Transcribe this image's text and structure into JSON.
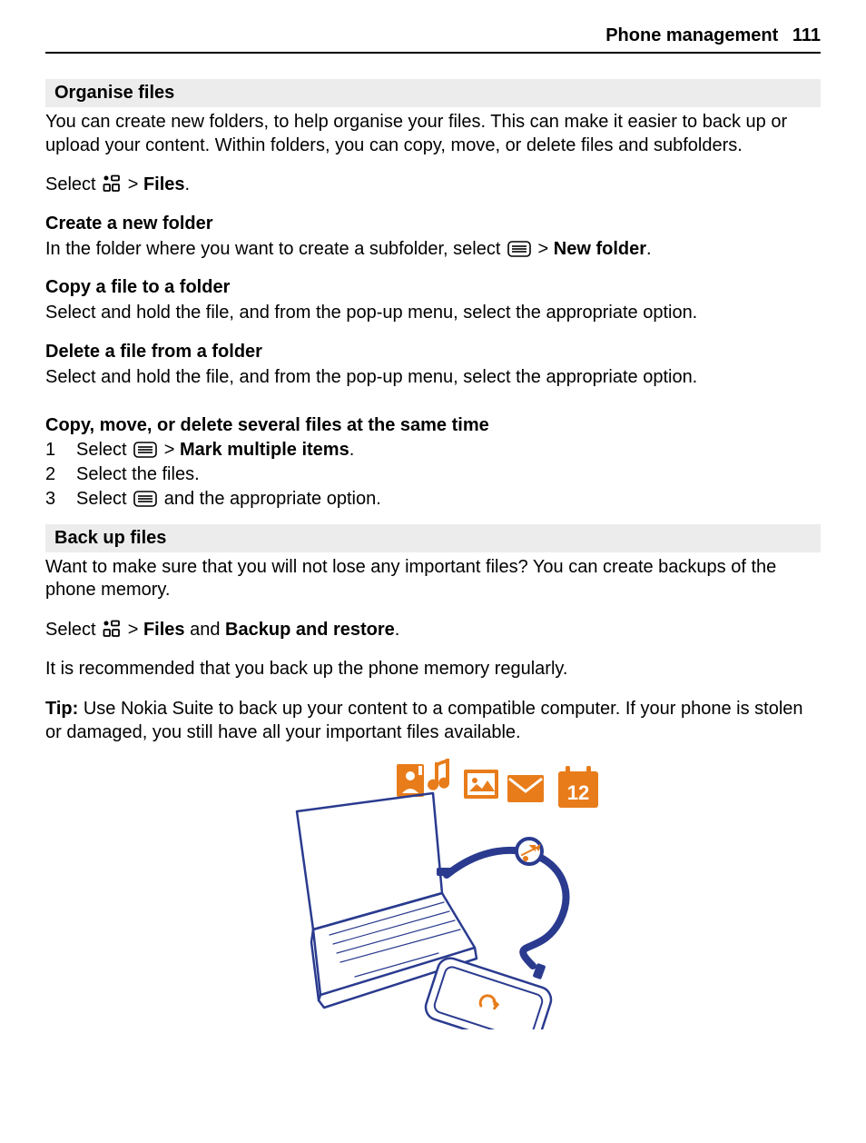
{
  "header": {
    "title": "Phone management",
    "page_number": "111"
  },
  "s1": {
    "title": "Organise files",
    "intro": "You can create new folders, to help organise your files. This can make it easier to back up or upload your content. Within folders, you can copy, move, or delete files and subfolders.",
    "select_pre": "Select ",
    "select_gt": " > ",
    "select_files": "Files",
    "select_dot": ".",
    "h_create": "Create a new folder",
    "create_pre": "In the folder where you want to create a subfolder, select ",
    "create_gt": " > ",
    "create_bold": "New folder",
    "create_dot": ".",
    "h_copy": "Copy a file to a folder",
    "copy_body": "Select and hold the file, and from the pop-up menu, select the appropriate option.",
    "h_delete": "Delete a file from a folder",
    "delete_body": "Select and hold the file, and from the pop-up menu, select the appropriate option.",
    "h_multi": "Copy, move, or delete several files at the same time",
    "step1_num": "1",
    "step1_pre": "Select ",
    "step1_gt": " > ",
    "step1_bold": "Mark multiple items",
    "step1_dot": ".",
    "step2_num": "2",
    "step2": "Select the files.",
    "step3_num": "3",
    "step3_pre": "Select ",
    "step3_post": " and the appropriate option."
  },
  "s2": {
    "title": "Back up files",
    "intro": "Want to make sure that you will not lose any important files? You can create backups of the phone memory.",
    "sel_pre": "Select ",
    "sel_gt": " > ",
    "sel_files": "Files",
    "sel_and": " and ",
    "sel_bkr": "Backup and restore",
    "sel_dot": ".",
    "rec": "It is recommended that you back up the phone memory regularly.",
    "tip_label": "Tip:",
    "tip_body": " Use Nokia Suite to back up your content to a compatible computer. If your phone is stolen or damaged, you still have all your important files available."
  },
  "illus": {
    "calendar_day": "12"
  }
}
